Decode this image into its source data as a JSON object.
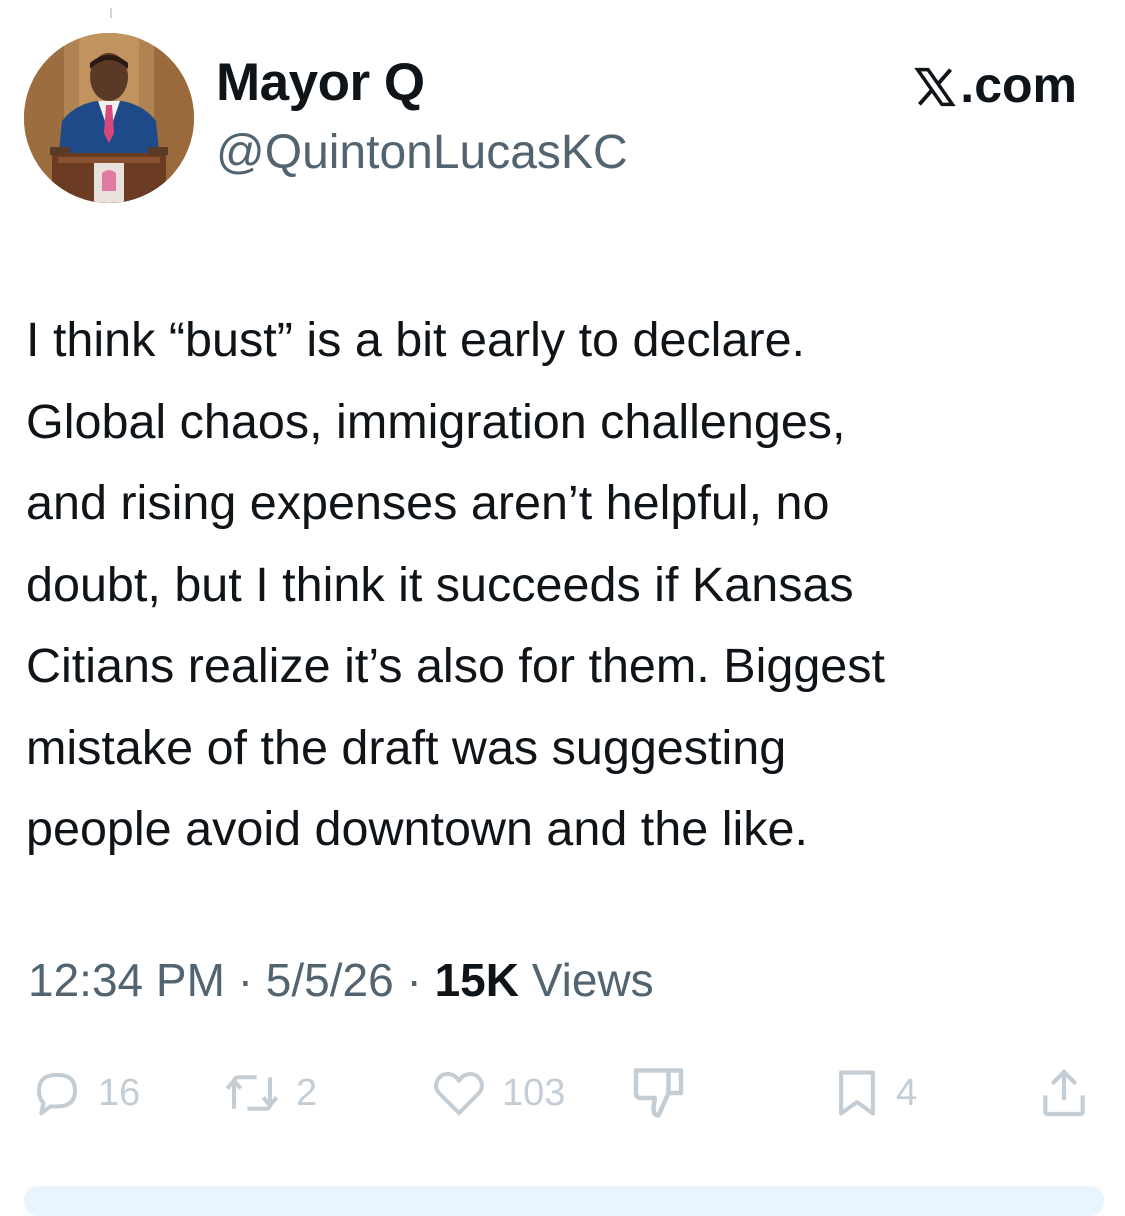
{
  "author": {
    "name": "Mayor Q",
    "handle": "@QuintonLucasKC"
  },
  "source": {
    "label": ".com",
    "logo_icon": "x-logo-icon"
  },
  "tweet": {
    "lines": [
      "I think “bust” is a bit early to declare.",
      "Global chaos, immigration challenges,",
      "and rising expenses aren’t helpful, no",
      "doubt, but I think it succeeds if Kansas",
      "Citians realize it’s also for them. Biggest",
      "mistake of the draft was suggesting",
      "people avoid downtown and the like."
    ]
  },
  "meta": {
    "time": "12:34 PM",
    "date": "5/5/26",
    "separator": "·",
    "views_count": "15K",
    "views_label": "Views"
  },
  "actions": {
    "replies": "16",
    "reposts": "2",
    "likes": "103",
    "bookmarks": "4",
    "icons": [
      "reply-icon",
      "repost-icon",
      "like-icon",
      "dislike-icon",
      "bookmark-icon",
      "share-icon"
    ]
  },
  "colors": {
    "text": "#0f1419",
    "secondary": "#536471",
    "action_faded": "#c5cdd4",
    "suit": "#1f4a8a",
    "tie": "#d8487a"
  }
}
